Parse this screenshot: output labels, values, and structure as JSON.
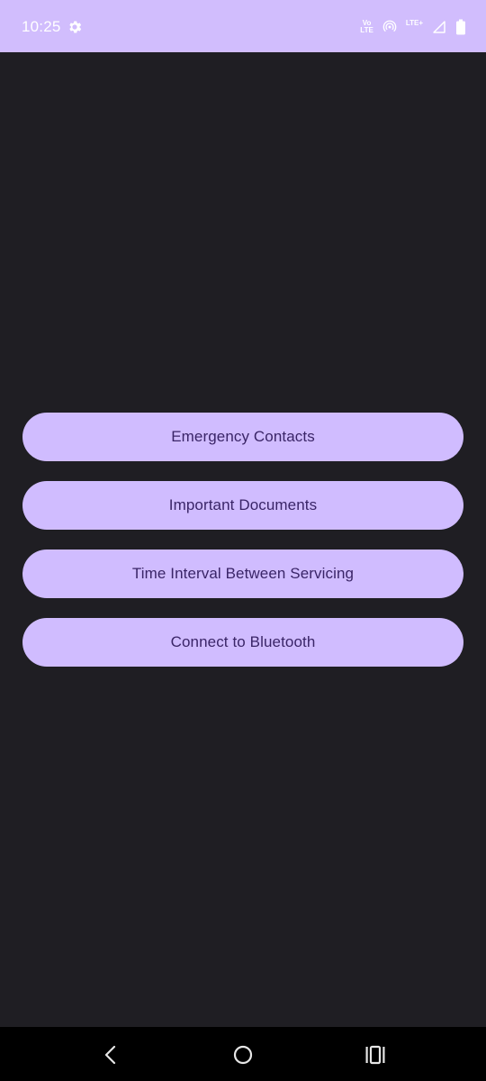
{
  "status_bar": {
    "time": "10:25",
    "settings_icon": "gear-icon",
    "volte_top": "Vo",
    "volte_bottom": "LTE",
    "hotspot_icon": "hotspot-icon",
    "network_label": "LTE+",
    "signal_icon": "signal-icon",
    "battery_icon": "battery-icon",
    "background_color": "#d1bdfd"
  },
  "main": {
    "background_color": "#1f1e23",
    "buttons": [
      {
        "label": "Emergency Contacts"
      },
      {
        "label": "Important Documents"
      },
      {
        "label": "Time Interval Between Servicing"
      },
      {
        "label": "Connect to Bluetooth"
      }
    ],
    "button_color": "#d0bcff",
    "button_text_color": "#3a2567"
  },
  "nav_bar": {
    "back_icon": "back-icon",
    "home_icon": "home-icon",
    "recents_icon": "recents-icon"
  }
}
